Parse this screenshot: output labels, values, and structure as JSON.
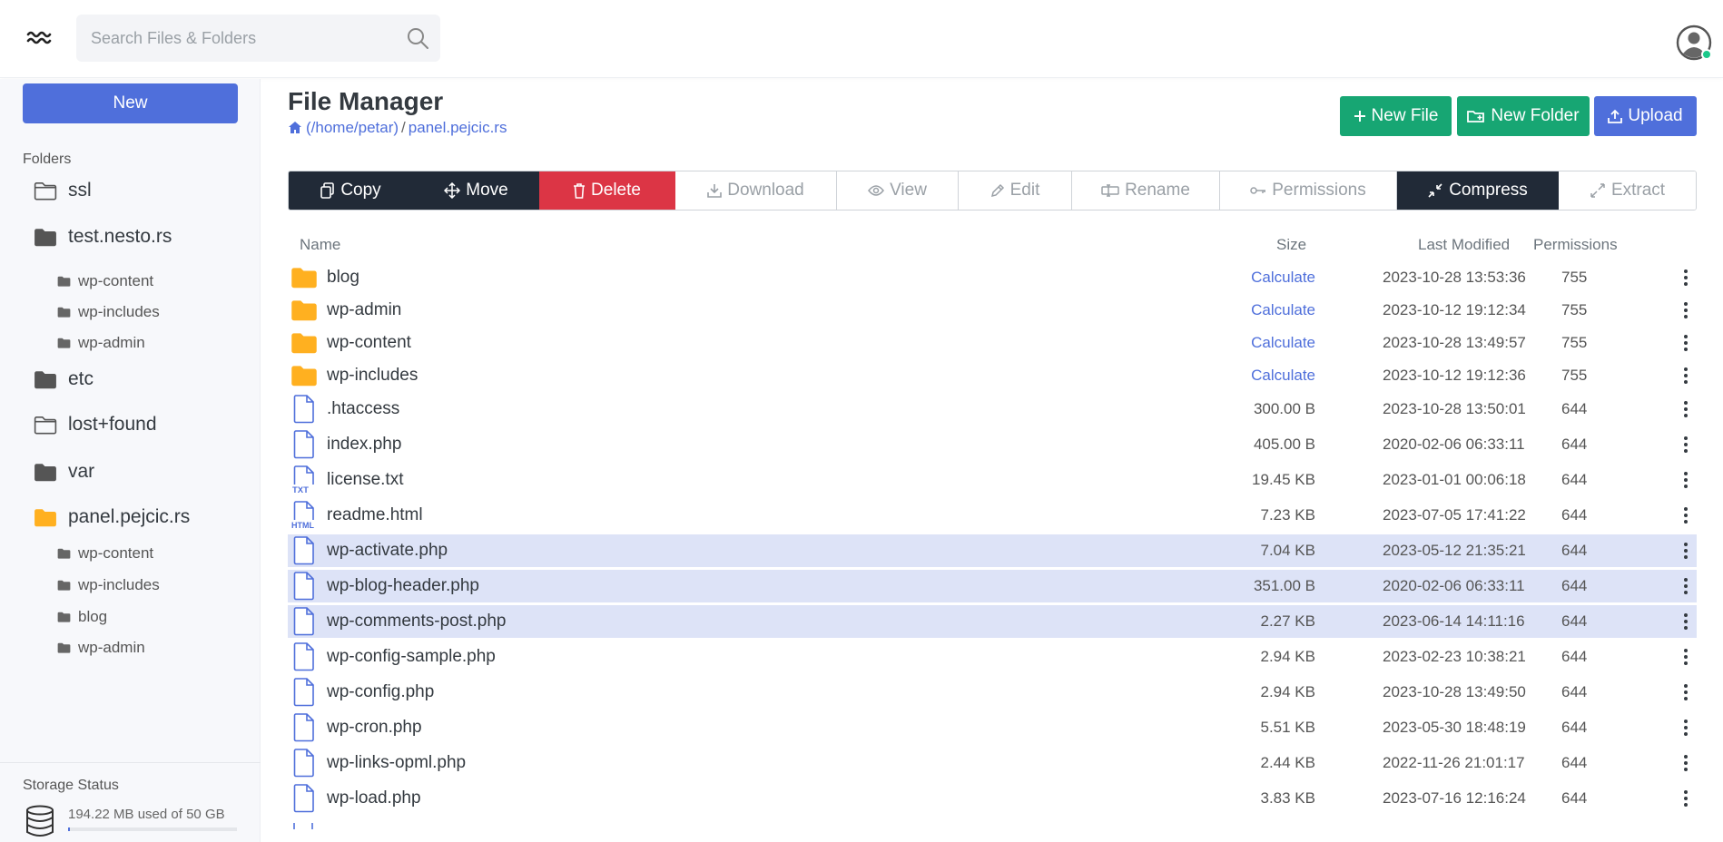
{
  "search": {
    "placeholder": "Search Files & Folders"
  },
  "sidebar": {
    "new_label": "New",
    "folders_label": "Folders",
    "tree": [
      {
        "label": "ssl",
        "level": 0,
        "icon": "folder-outline-icon"
      },
      {
        "label": "test.nesto.rs",
        "level": 0,
        "icon": "folder-solid-icon"
      },
      {
        "label": "wp-content",
        "level": 1,
        "icon": "folder-solid-icon"
      },
      {
        "label": "wp-includes",
        "level": 1,
        "icon": "folder-solid-icon"
      },
      {
        "label": "wp-admin",
        "level": 1,
        "icon": "folder-solid-icon"
      },
      {
        "label": "etc",
        "level": 0,
        "icon": "folder-solid-icon"
      },
      {
        "label": "lost+found",
        "level": 0,
        "icon": "folder-outline-icon"
      },
      {
        "label": "var",
        "level": 0,
        "icon": "folder-solid-icon"
      },
      {
        "label": "panel.pejcic.rs",
        "level": 0,
        "icon": "folder-open-icon"
      },
      {
        "label": "wp-content",
        "level": 1,
        "icon": "folder-solid-icon"
      },
      {
        "label": "wp-includes",
        "level": 1,
        "icon": "folder-solid-icon"
      },
      {
        "label": "blog",
        "level": 1,
        "icon": "folder-solid-icon"
      },
      {
        "label": "wp-admin",
        "level": 1,
        "icon": "folder-solid-icon"
      }
    ],
    "storage": {
      "label": "Storage Status",
      "text": "194.22 MB used of 50 GB",
      "fraction": 0.004
    }
  },
  "main": {
    "title": "File Manager",
    "breadcrumb": {
      "home": "(/home/petar)",
      "separator": "/",
      "current": "panel.pejcic.rs"
    },
    "actions": {
      "new_file": "New File",
      "new_folder": "New Folder",
      "upload": "Upload"
    },
    "toolbar": {
      "copy": "Copy",
      "move": "Move",
      "delete": "Delete",
      "download": "Download",
      "view": "View",
      "edit": "Edit",
      "rename": "Rename",
      "permissions": "Permissions",
      "compress": "Compress",
      "extract": "Extract"
    },
    "columns": {
      "name": "Name",
      "size": "Size",
      "modified": "Last Modified",
      "permissions": "Permissions"
    },
    "files": [
      {
        "name": "blog",
        "type": "folder",
        "size": "Calculate",
        "modified": "2023-10-28 13:53:36",
        "perm": "755",
        "selected": false
      },
      {
        "name": "wp-admin",
        "type": "folder",
        "size": "Calculate",
        "modified": "2023-10-12 19:12:34",
        "perm": "755",
        "selected": false
      },
      {
        "name": "wp-content",
        "type": "folder",
        "size": "Calculate",
        "modified": "2023-10-28 13:49:57",
        "perm": "755",
        "selected": false
      },
      {
        "name": "wp-includes",
        "type": "folder",
        "size": "Calculate",
        "modified": "2023-10-12 19:12:36",
        "perm": "755",
        "selected": false
      },
      {
        "name": ".htaccess",
        "type": "file",
        "size": "300.00 B",
        "modified": "2023-10-28 13:50:01",
        "perm": "644",
        "selected": false
      },
      {
        "name": "index.php",
        "type": "file",
        "size": "405.00 B",
        "modified": "2020-02-06 06:33:11",
        "perm": "644",
        "selected": false
      },
      {
        "name": "license.txt",
        "type": "file",
        "badge": "TXT",
        "size": "19.45 KB",
        "modified": "2023-01-01 00:06:18",
        "perm": "644",
        "selected": false
      },
      {
        "name": "readme.html",
        "type": "file",
        "badge": "HTML",
        "size": "7.23 KB",
        "modified": "2023-07-05 17:41:22",
        "perm": "644",
        "selected": false
      },
      {
        "name": "wp-activate.php",
        "type": "file",
        "size": "7.04 KB",
        "modified": "2023-05-12 21:35:21",
        "perm": "644",
        "selected": true
      },
      {
        "name": "wp-blog-header.php",
        "type": "file",
        "size": "351.00 B",
        "modified": "2020-02-06 06:33:11",
        "perm": "644",
        "selected": true
      },
      {
        "name": "wp-comments-post.php",
        "type": "file",
        "size": "2.27 KB",
        "modified": "2023-06-14 14:11:16",
        "perm": "644",
        "selected": true
      },
      {
        "name": "wp-config-sample.php",
        "type": "file",
        "size": "2.94 KB",
        "modified": "2023-02-23 10:38:21",
        "perm": "644",
        "selected": false
      },
      {
        "name": "wp-config.php",
        "type": "file",
        "size": "2.94 KB",
        "modified": "2023-10-28 13:49:50",
        "perm": "644",
        "selected": false
      },
      {
        "name": "wp-cron.php",
        "type": "file",
        "size": "5.51 KB",
        "modified": "2023-05-30 18:48:19",
        "perm": "644",
        "selected": false
      },
      {
        "name": "wp-links-opml.php",
        "type": "file",
        "size": "2.44 KB",
        "modified": "2022-11-26 21:01:17",
        "perm": "644",
        "selected": false
      },
      {
        "name": "wp-load.php",
        "type": "file",
        "size": "3.83 KB",
        "modified": "2023-07-16 12:16:24",
        "perm": "644",
        "selected": false
      }
    ]
  },
  "colors": {
    "primary": "#4f6fdb",
    "success": "#17a673",
    "danger": "#dc3545",
    "dark": "#212a37",
    "folder": "#ffb020",
    "selected_row": "#dde3f7",
    "online": "#1cc88a"
  }
}
